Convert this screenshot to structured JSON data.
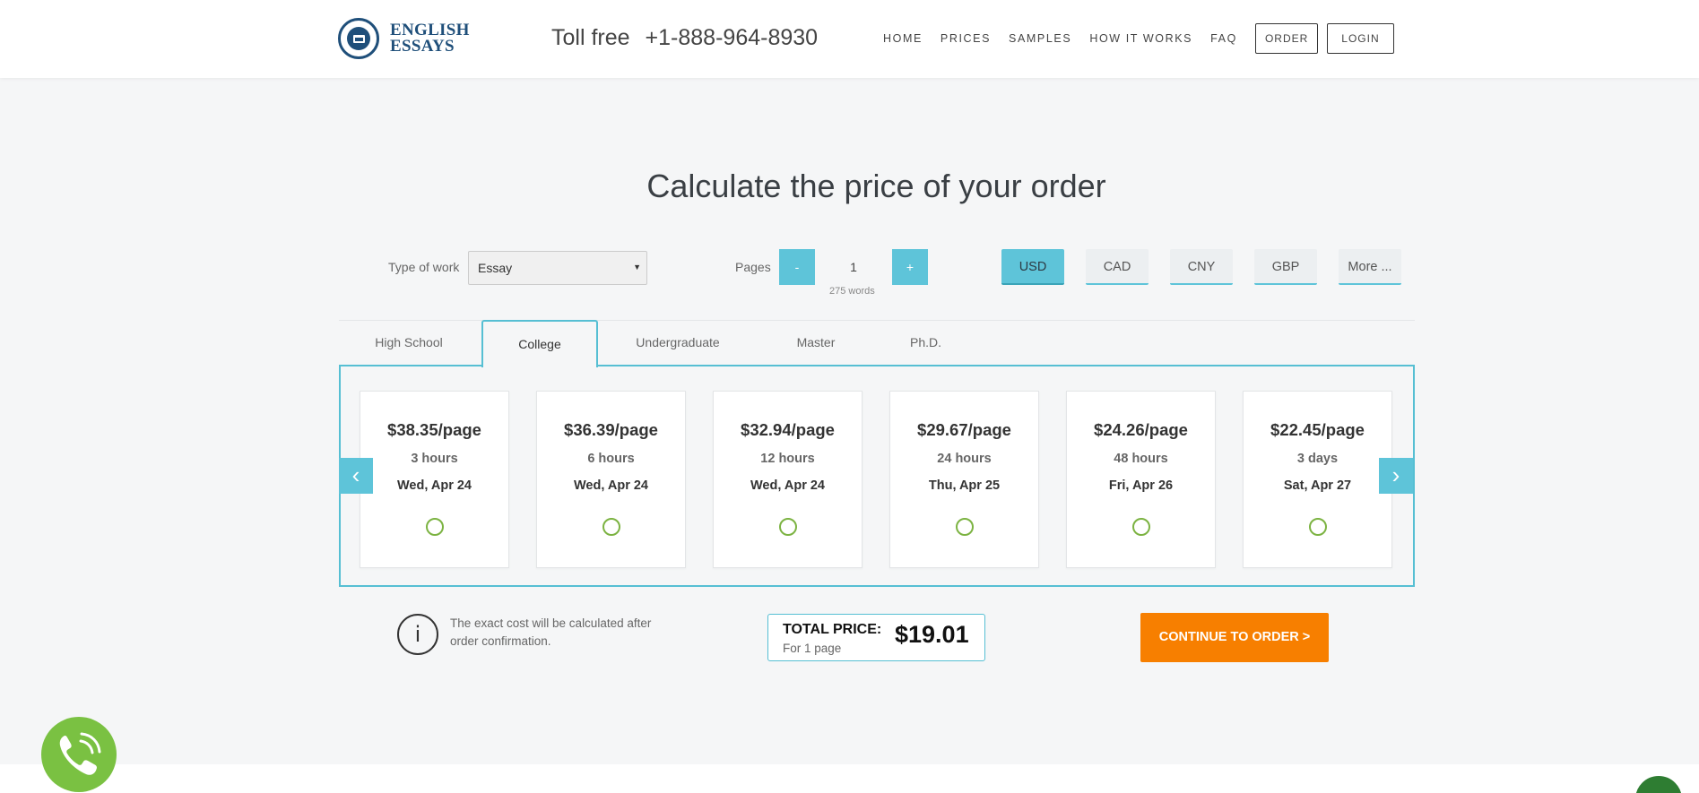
{
  "header": {
    "logo_line1": "ENGLISH",
    "logo_line2": "ESSAYS",
    "toll_free_label": "Toll free",
    "phone": "+1-888-964-8930",
    "nav": [
      "HOME",
      "PRICES",
      "SAMPLES",
      "HOW IT WORKS",
      "FAQ"
    ],
    "order_label": "ORDER",
    "login_label": "LOGIN"
  },
  "title": "Calculate the price of your order",
  "controls": {
    "type_label": "Type of work",
    "type_value": "Essay",
    "pages_label": "Pages",
    "minus": "-",
    "plus": "+",
    "pages_value": "1",
    "words": "275 words",
    "currencies": [
      "USD",
      "CAD",
      "CNY",
      "GBP",
      "More ..."
    ],
    "active_currency": "USD"
  },
  "tabs": [
    "High School",
    "College",
    "Undergraduate",
    "Master",
    "Ph.D."
  ],
  "active_tab": "College",
  "cards": [
    {
      "price": "$38.35/page",
      "duration": "3 hours",
      "date": "Wed, Apr 24"
    },
    {
      "price": "$36.39/page",
      "duration": "6 hours",
      "date": "Wed, Apr 24"
    },
    {
      "price": "$32.94/page",
      "duration": "12 hours",
      "date": "Wed, Apr 24"
    },
    {
      "price": "$29.67/page",
      "duration": "24 hours",
      "date": "Thu, Apr 25"
    },
    {
      "price": "$24.26/page",
      "duration": "48 hours",
      "date": "Fri, Apr 26"
    },
    {
      "price": "$22.45/page",
      "duration": "3 days",
      "date": "Sat, Apr 27"
    }
  ],
  "info": {
    "icon_glyph": "i",
    "text": "The exact cost will be calculated after order confirmation."
  },
  "total": {
    "label": "TOTAL PRICE:",
    "sub": "For 1 page",
    "value": "$19.01"
  },
  "cta_label": "CONTINUE TO ORDER >",
  "colors": {
    "accent": "#5ec4d9",
    "cta": "#f77f00",
    "call": "#7ac142",
    "brand": "#1f4f7a"
  }
}
